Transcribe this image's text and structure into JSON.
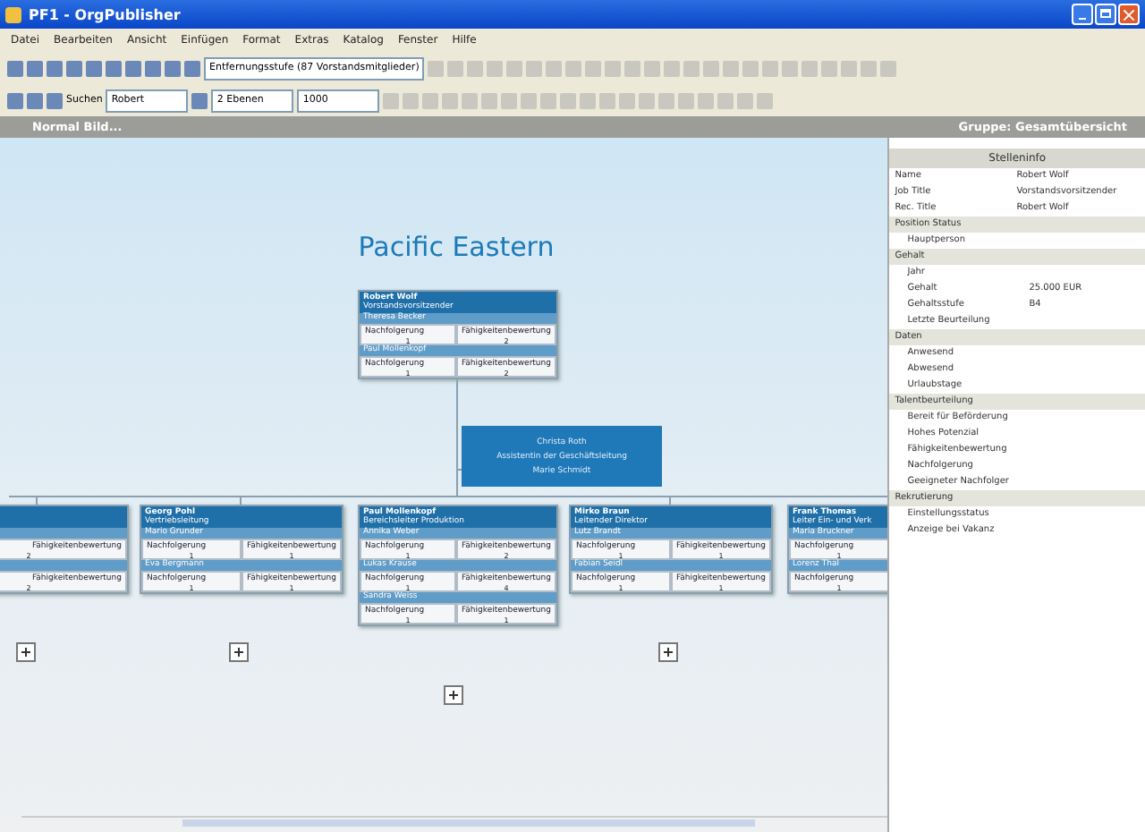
{
  "window": {
    "title": "PF1 - OrgPublisher"
  },
  "menu": [
    "Datei",
    "Bearbeiten",
    "Ansicht",
    "Einfügen",
    "Format",
    "Extras",
    "Katalog",
    "Fenster",
    "Hilfe"
  ],
  "toolbar": {
    "zoom_combo": "Entfernungsstufe (87 Vorstandsmitglieder)",
    "search_label": "Suchen",
    "search_field": "Robert",
    "levels_combo": "2 Ebenen",
    "size_combo": "1000"
  },
  "view_bar": {
    "left": "Normal Bild...",
    "right": "Gruppe: Gesamtübersicht"
  },
  "chart": {
    "title": "Pacific Eastern",
    "nodes": [
      {
        "name": "Robert Wolf",
        "title": "Vorstandsvorsitzender",
        "sections": [
          {
            "label": "Theresa Becker",
            "cells": [
              {
                "label": "Nachfolgerung",
                "value": "1"
              },
              {
                "label": "Fähigkeitenbewertung",
                "value": "2"
              }
            ]
          },
          {
            "label": "Paul Mollenkopf",
            "cells": [
              {
                "label": "Nachfolgerung",
                "value": "1"
              },
              {
                "label": "Fähigkeitenbewertung",
                "value": "2"
              }
            ]
          }
        ]
      },
      {
        "sections": [
          {
            "cells": [
              {
                "label": "Fähigkeitenbewertung",
                "value": "2"
              }
            ]
          },
          {
            "cells": [
              {
                "label": "Fähigkeitenbewertung",
                "value": "2"
              }
            ]
          }
        ]
      },
      {
        "name": "Georg Pohl",
        "title": "Vertriebsleitung",
        "sections": [
          {
            "label": "Mario Grunder",
            "cells": [
              {
                "label": "Nachfolgerung",
                "value": "1"
              },
              {
                "label": "Fähigkeitenbewertung",
                "value": "1"
              }
            ]
          },
          {
            "label": "Eva Bergmann",
            "cells": [
              {
                "label": "Nachfolgerung",
                "value": "1"
              },
              {
                "label": "Fähigkeitenbewertung",
                "value": "1"
              }
            ]
          }
        ]
      },
      {
        "name": "Paul Mollenkopf",
        "title": "Bereichsleiter Produktion",
        "sections": [
          {
            "label": "Annika Weber",
            "cells": [
              {
                "label": "Nachfolgerung",
                "value": "1"
              },
              {
                "label": "Fähigkeitenbewertung",
                "value": "2"
              }
            ]
          },
          {
            "label": "Lukas Krause",
            "cells": [
              {
                "label": "Nachfolgerung",
                "value": "1"
              },
              {
                "label": "Fähigkeitenbewertung",
                "value": "4"
              }
            ]
          },
          {
            "label": "Sandra Weiss",
            "cells": [
              {
                "label": "Nachfolgerung",
                "value": "1"
              },
              {
                "label": "Fähigkeitenbewertung",
                "value": "1"
              }
            ]
          }
        ]
      },
      {
        "name": "Mirko Braun",
        "title": "Leitender Direktor",
        "sections": [
          {
            "label": "Lutz Brandt",
            "cells": [
              {
                "label": "Nachfolgerung",
                "value": "1"
              },
              {
                "label": "Fähigkeitenbewertung",
                "value": "1"
              }
            ]
          },
          {
            "label": "Fabian Seidl",
            "cells": [
              {
                "label": "Nachfolgerung",
                "value": "1"
              },
              {
                "label": "Fähigkeitenbewertung",
                "value": "1"
              }
            ]
          }
        ]
      },
      {
        "name": "Frank Thomas",
        "title": "Leiter Ein- und Verk",
        "sections": [
          {
            "label": "Maria Bruckner",
            "cells": [
              {
                "label": "Nachfolgerung",
                "value": "1"
              }
            ]
          },
          {
            "label": "Lorenz Thal",
            "cells": [
              {
                "label": "Nachfolgerung",
                "value": "1"
              }
            ]
          }
        ]
      }
    ],
    "assistant": {
      "name": "Christa Roth",
      "title": "Assistentin der Geschäftsleitung",
      "note": "Marie Schmidt"
    }
  },
  "panel": {
    "header": "Stelleninfo",
    "groups": [
      {
        "rows": [
          {
            "label": "Name",
            "value": "Robert Wolf"
          },
          {
            "label": "Job Title",
            "value": "Vorstandsvorsitzender"
          },
          {
            "label": "Rec. Title",
            "value": "Robert Wolf"
          }
        ]
      },
      {
        "label": "Position Status",
        "rows": [
          {
            "label": "Hauptperson",
            "value": ""
          }
        ]
      },
      {
        "label": "Gehalt",
        "rows": [
          {
            "label": "Jahr",
            "value": ""
          },
          {
            "label": "Gehalt",
            "value": "25.000 EUR"
          },
          {
            "label": "Gehaltsstufe",
            "value": "B4"
          },
          {
            "label": "Letzte Beurteilung",
            "value": ""
          }
        ]
      },
      {
        "label": "Daten",
        "rows": [
          {
            "label": "Anwesend",
            "value": ""
          },
          {
            "label": "Abwesend",
            "value": ""
          },
          {
            "label": "Urlaubstage",
            "value": ""
          }
        ]
      },
      {
        "label": "Talentbeurteilung",
        "rows": [
          {
            "label": "Bereit für Beförderung",
            "value": ""
          },
          {
            "label": "Hohes Potenzial",
            "value": ""
          },
          {
            "label": "Fähigkeitenbewertung",
            "value": ""
          },
          {
            "label": "Nachfolgerung",
            "value": ""
          },
          {
            "label": "Geeigneter Nachfolger",
            "value": ""
          }
        ]
      },
      {
        "label": "Rekrutierung",
        "rows": [
          {
            "label": "Einstellungsstatus",
            "value": ""
          },
          {
            "label": "Anzeige bei Vakanz",
            "value": ""
          }
        ]
      }
    ]
  }
}
